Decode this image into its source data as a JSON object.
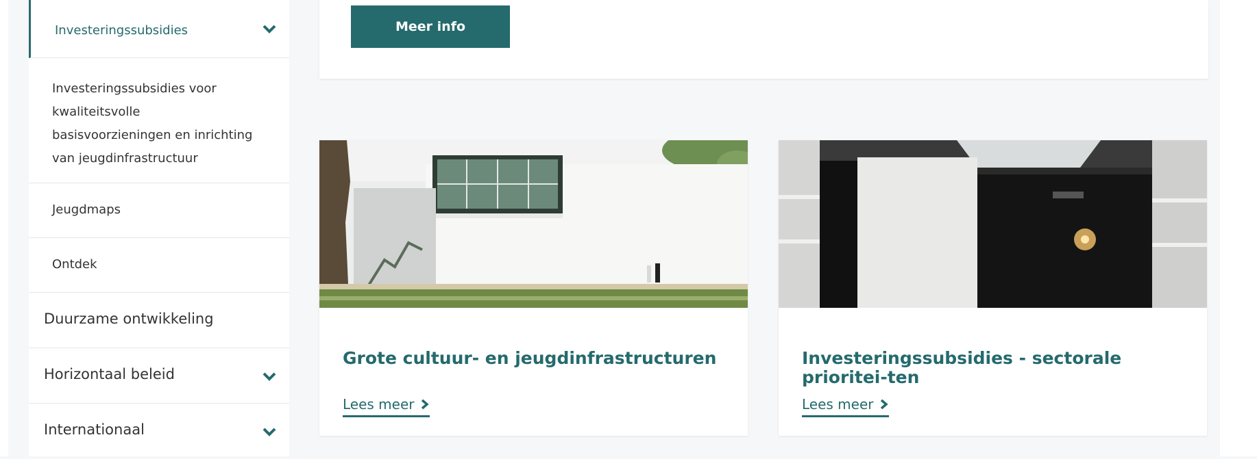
{
  "sidebar": {
    "active_item": {
      "label": "Investeringssubsidies",
      "icon": "chevron-down-icon"
    },
    "sub_items": [
      {
        "label": "Investeringssubsidies voor kwaliteitsvolle basisvoorzieningen en inrichting van jeugdinfrastructuur"
      },
      {
        "label": "Jeugdmaps"
      },
      {
        "label": "Ontdek"
      }
    ],
    "top_items": [
      {
        "label": "Duurzame ontwikkeling",
        "has_chevron": false
      },
      {
        "label": "Horizontaal beleid",
        "has_chevron": true,
        "icon": "chevron-down-icon"
      },
      {
        "label": "Internationaal",
        "has_chevron": true,
        "icon": "chevron-down-icon"
      }
    ]
  },
  "main": {
    "meer_info_label": "Meer info",
    "cards": [
      {
        "title": "Grote cultuur- en jeugdinfrastructuren",
        "link_label": "Lees meer",
        "image": "building-photo"
      },
      {
        "title": "Investeringssubsidies - sectorale prioritei-ten",
        "link_label": "Lees meer",
        "image": "hall-photo"
      }
    ]
  },
  "colors": {
    "accent": "#256a6d",
    "background": "#f6f7f8",
    "card": "#ffffff"
  }
}
